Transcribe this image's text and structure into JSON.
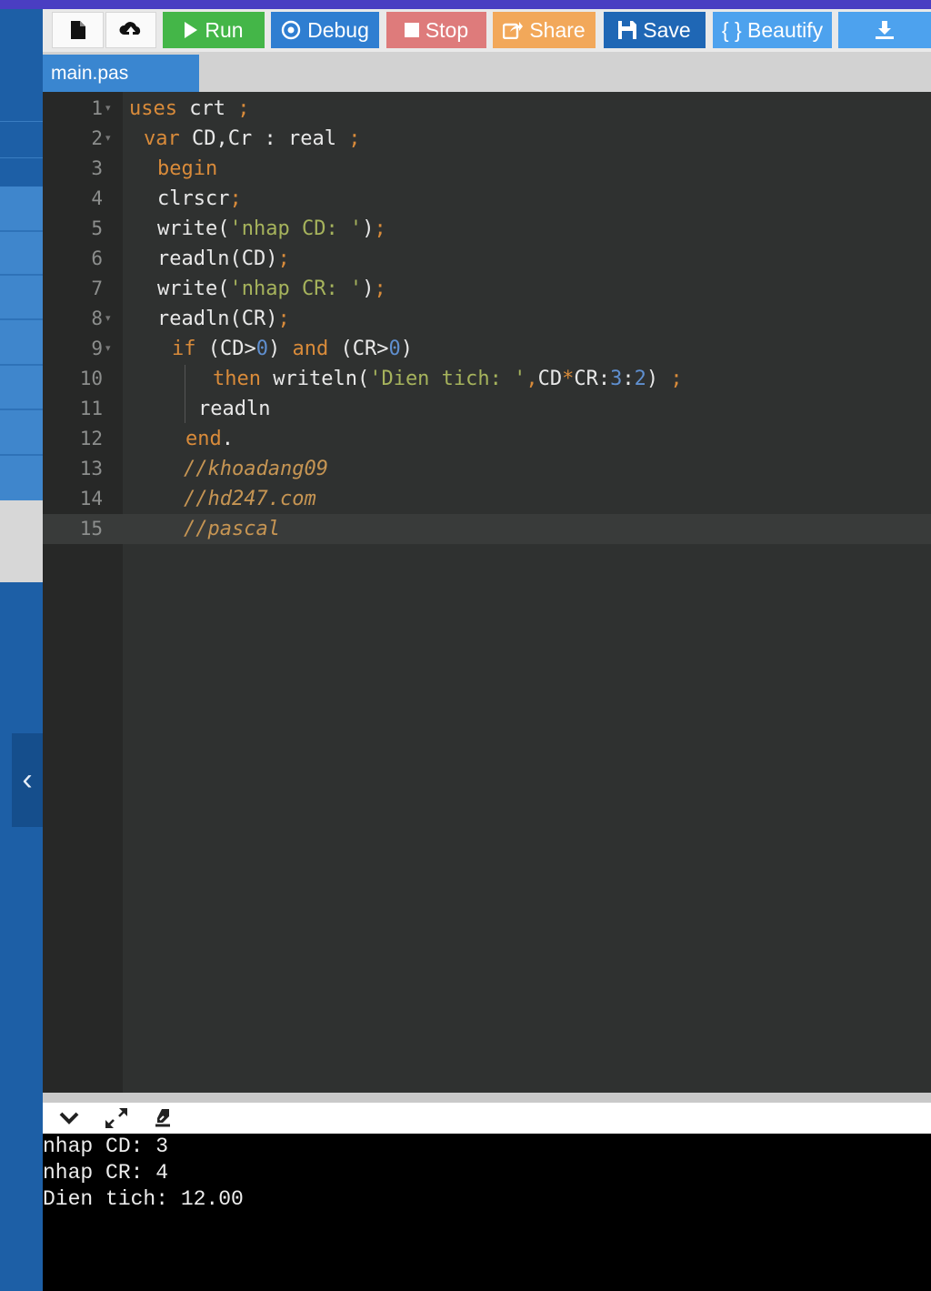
{
  "toolbar": {
    "new_file_icon": "file-icon",
    "upload_icon": "cloud-upload-icon",
    "run_label": "Run",
    "debug_label": "Debug",
    "stop_label": "Stop",
    "share_label": "Share",
    "save_label": "Save",
    "beautify_label": "{ } Beautify",
    "download_icon": "download-icon"
  },
  "tabs": [
    {
      "label": "main.pas"
    }
  ],
  "editor": {
    "line_numbers": [
      "1",
      "2",
      "3",
      "4",
      "5",
      "6",
      "7",
      "8",
      "9",
      "10",
      "11",
      "12",
      "13",
      "14",
      "15"
    ],
    "active_line": 15,
    "lines": {
      "l1": {
        "kw": "uses",
        "rest": " crt ",
        "semi": ";"
      },
      "l2": {
        "kw": "var",
        "rest": " CD,Cr : real ",
        "semi": ";"
      },
      "l3": {
        "kw": "begin"
      },
      "l4": {
        "rest": "clrscr",
        "semi": ";"
      },
      "l5": {
        "pre": "write(",
        "str": "'nhap CD: '",
        "post": ")",
        "semi": ";"
      },
      "l6": {
        "rest": "readln(CD)",
        "semi": ";"
      },
      "l7": {
        "pre": "write(",
        "str": "'nhap CR: '",
        "post": ")",
        "semi": ";"
      },
      "l8": {
        "rest": "readln(CR)",
        "semi": ";"
      },
      "l9": {
        "kw": "if",
        "a": " (CD>",
        "n1": "0",
        "b": ") ",
        "kw2": "and",
        "c": " (CR>",
        "n2": "0",
        "d": ")"
      },
      "l10": {
        "kw": "then",
        "a": " writeln(",
        "str": "'Dien tich: '",
        "comma": ",",
        "b": "CD",
        "op": "*",
        "c": "CR:",
        "n1": "3",
        "d": ":",
        "n2": "2",
        "e": ") ",
        "semi": ";"
      },
      "l11": {
        "rest": "readln"
      },
      "l12": {
        "kw": "end",
        "rest": "."
      },
      "l13": {
        "cm": "//khoadang09"
      },
      "l14": {
        "cm": "//hd247.com"
      },
      "l15": {
        "cm": "//pascal"
      }
    }
  },
  "console": {
    "collapse_icon": "chevron-down-icon",
    "expand_icon": "expand-icon",
    "clear_icon": "eraser-icon",
    "output": [
      "nhap CD: 3",
      "nhap CR: 4",
      "Dien tich: 12.00"
    ]
  },
  "sidebar": {
    "toggle_icon": "chevron-left-icon",
    "toggle_glyph": "‹"
  }
}
